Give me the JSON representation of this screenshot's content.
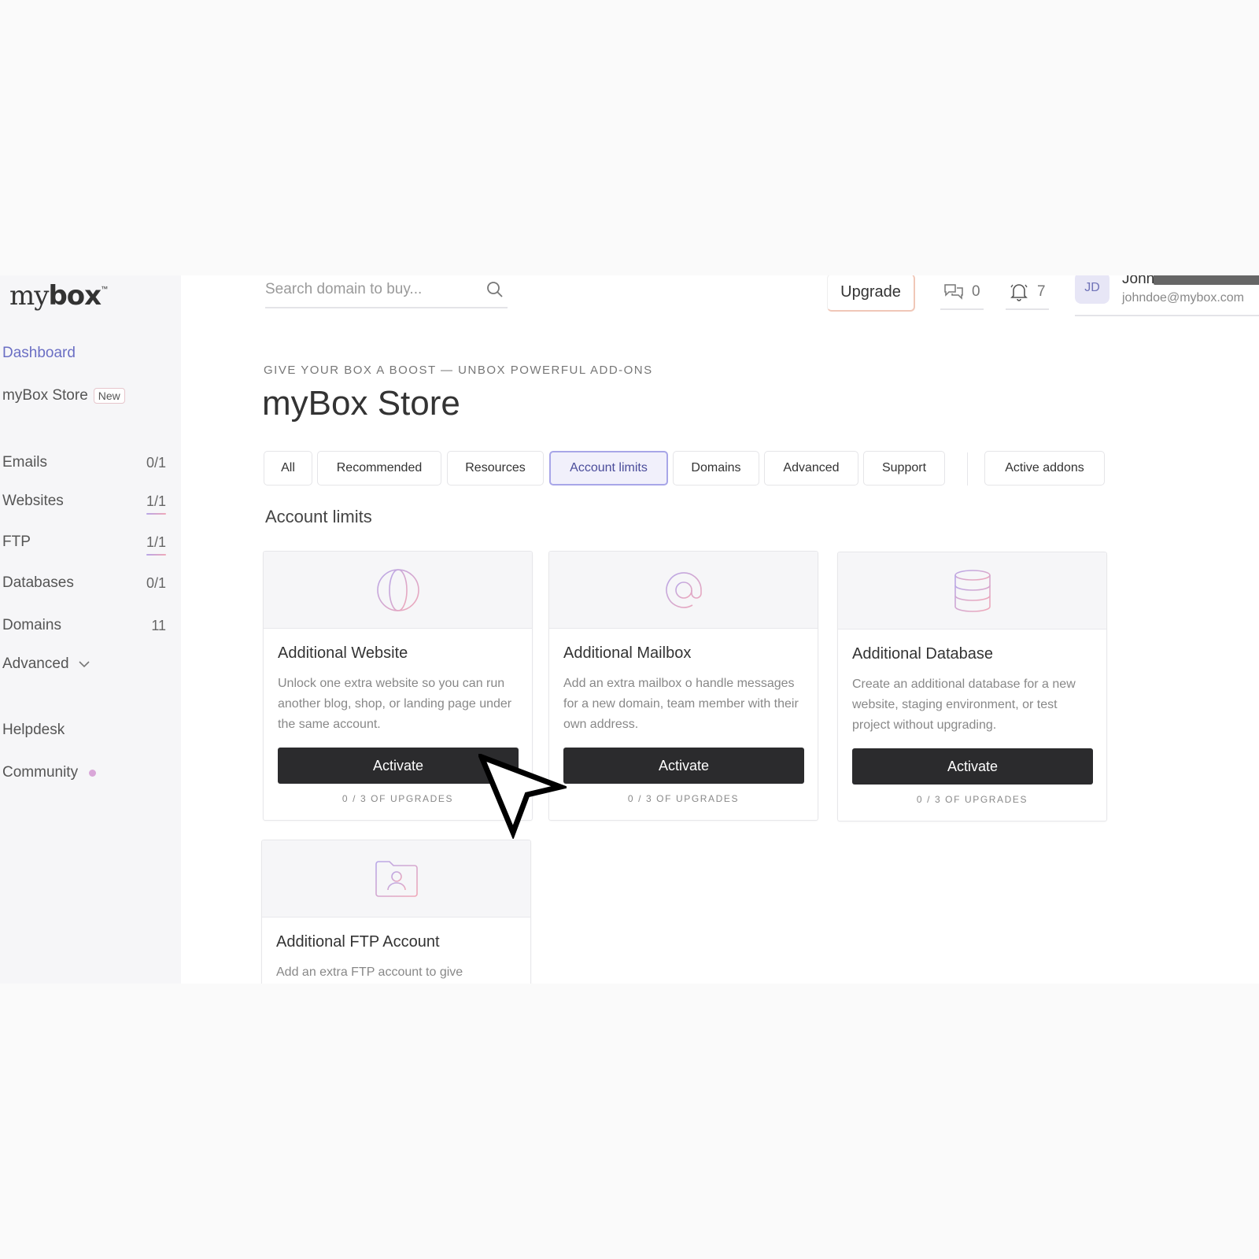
{
  "brand": {
    "logo_light": "my",
    "logo_bold": "box",
    "tm": "™"
  },
  "sidebar": {
    "dashboard": "Dashboard",
    "store": {
      "label": "myBox Store",
      "badge": "New"
    },
    "items": [
      {
        "label": "Emails",
        "count": "0/1"
      },
      {
        "label": "Websites",
        "count": "1/1"
      },
      {
        "label": "FTP",
        "count": "1/1"
      },
      {
        "label": "Databases",
        "count": "0/1"
      },
      {
        "label": "Domains",
        "count": "11"
      }
    ],
    "advanced": "Advanced",
    "helpdesk": "Helpdesk",
    "community": "Community"
  },
  "header": {
    "search_placeholder": "Search domain to buy...",
    "upgrade_label": "Upgrade",
    "messages_count": "0",
    "notifications_count": "7",
    "user": {
      "initials": "JD",
      "name": "John",
      "email": "johndoe@mybox.com"
    }
  },
  "main": {
    "eyebrow": "GIVE YOUR BOX A BOOST — UNBOX POWERFUL ADD-ONS",
    "title": "myBox Store",
    "tabs": [
      "All",
      "Recommended",
      "Resources",
      "Account limits",
      "Domains",
      "Advanced",
      "Support"
    ],
    "active_tab": "Account limits",
    "active_addons_label": "Active addons",
    "section_title": "Account limits",
    "cards": [
      {
        "icon": "globe-icon",
        "title": "Additional Website",
        "description": "Unlock one extra website so you can run another blog, shop, or landing page under the same account.",
        "button": "Activate",
        "upgrades": "0 / 3 OF UPGRADES"
      },
      {
        "icon": "at-sign-icon",
        "title": "Additional Mailbox",
        "description": "Add an extra mailbox o handle messages for a new domain, team member with their own address.",
        "button": "Activate",
        "upgrades": "0 / 3 OF UPGRADES"
      },
      {
        "icon": "database-icon",
        "title": "Additional Database",
        "description": "Create an additional database for a new website, staging environment, or test project without upgrading.",
        "button": "Activate",
        "upgrades": "0 / 3 OF UPGRADES"
      },
      {
        "icon": "folder-user-icon",
        "title": "Additional FTP Account",
        "description": "Add an extra FTP account to give"
      }
    ]
  },
  "colors": {
    "accent": "#6b6fc4",
    "button_dark": "#2b2b2d",
    "gradient_start": "#b8a7e8",
    "gradient_end": "#f0a8b8"
  }
}
